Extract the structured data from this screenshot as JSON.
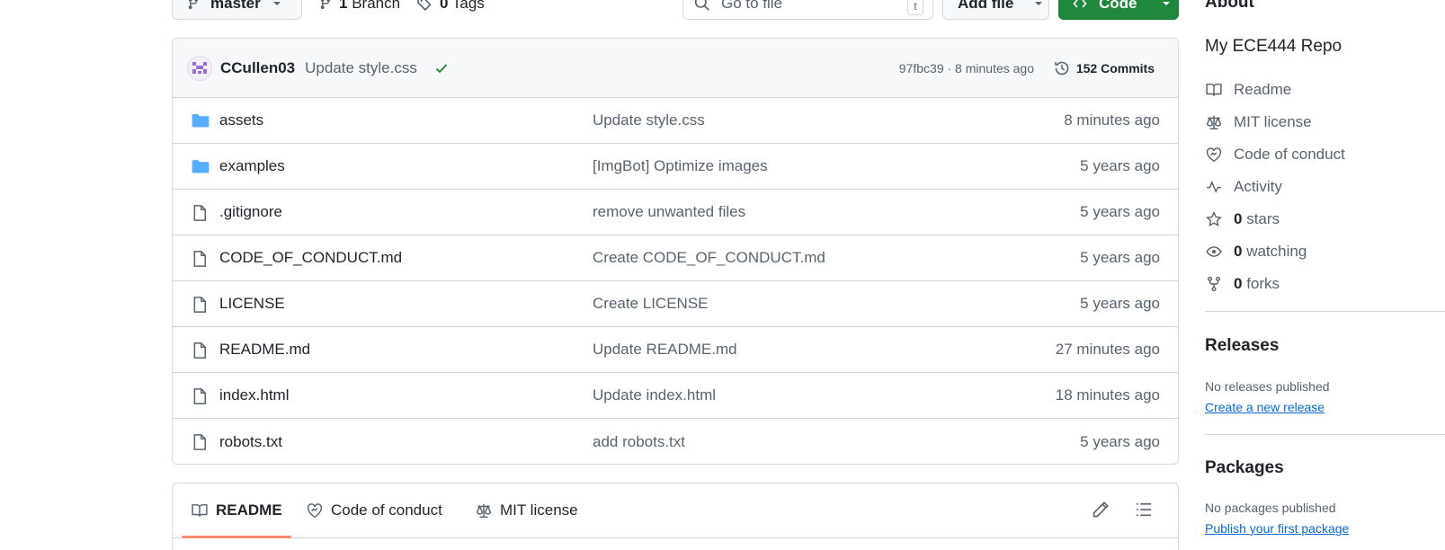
{
  "toolbar": {
    "branch": "master",
    "branches_count": "1",
    "branches_label": "Branch",
    "tags_count": "0",
    "tags_label": "Tags",
    "search_placeholder": "Go to file",
    "search_shortcut": "t",
    "add_file": "Add file",
    "code": "Code"
  },
  "commit": {
    "author": "CCullen03",
    "message": "Update style.css",
    "meta": "97fbc39 · 8 minutes ago",
    "commits_count": "152",
    "commits_label": "Commits",
    "status_color": "#1a7f37"
  },
  "files": [
    {
      "name": "assets",
      "type": "folder",
      "message": "Update style.css",
      "age": "8 minutes ago"
    },
    {
      "name": "examples",
      "type": "folder",
      "message": "[ImgBot] Optimize images",
      "age": "5 years ago"
    },
    {
      "name": ".gitignore",
      "type": "file",
      "message": "remove unwanted files",
      "age": "5 years ago"
    },
    {
      "name": "CODE_OF_CONDUCT.md",
      "type": "file",
      "message": "Create CODE_OF_CONDUCT.md",
      "age": "5 years ago"
    },
    {
      "name": "LICENSE",
      "type": "file",
      "message": "Create LICENSE",
      "age": "5 years ago"
    },
    {
      "name": "README.md",
      "type": "file",
      "message": "Update README.md",
      "age": "27 minutes ago"
    },
    {
      "name": "index.html",
      "type": "file",
      "message": "Update index.html",
      "age": "18 minutes ago"
    },
    {
      "name": "robots.txt",
      "type": "file",
      "message": "add robots.txt",
      "age": "5 years ago"
    }
  ],
  "readme_tabs": {
    "readme": "README",
    "conduct": "Code of conduct",
    "license": "MIT license"
  },
  "about": {
    "heading": "About",
    "description": "My ECE444 Repo",
    "links": {
      "readme": "Readme",
      "license": "MIT license",
      "conduct": "Code of conduct",
      "activity": "Activity",
      "stars_count": "0",
      "stars_label": "stars",
      "watching_count": "0",
      "watching_label": "watching",
      "forks_count": "0",
      "forks_label": "forks"
    }
  },
  "releases": {
    "heading": "Releases",
    "note": "No releases published",
    "link": "Create a new release"
  },
  "packages": {
    "heading": "Packages",
    "note": "No packages published",
    "link": "Publish your first package"
  },
  "colors": {
    "accent_green": "#1f883d",
    "folder_blue": "#54aeff",
    "link_blue": "#0969da",
    "active_tab_underline": "#fd8c73"
  }
}
